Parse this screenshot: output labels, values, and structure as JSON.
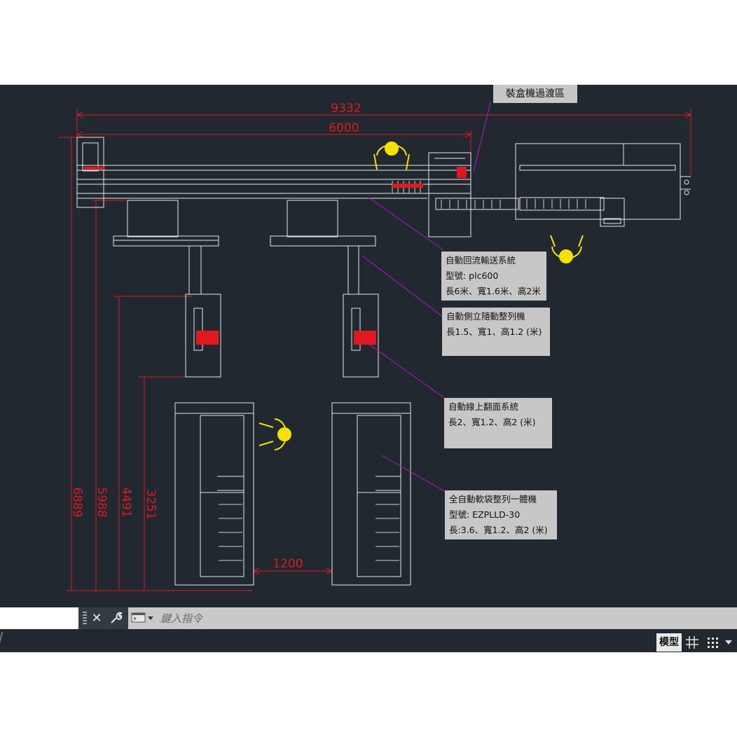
{
  "dimensions": {
    "total_width": "9332",
    "conveyor_length": "6000",
    "gap": "1200",
    "height_6889": "6889",
    "height_5988": "5988",
    "height_4491": "4491",
    "height_3251": "3251"
  },
  "labels": {
    "transition_zone": "裝盒機過渡區"
  },
  "callouts": {
    "return_conveyor": {
      "line1": "自動回流輸送系統",
      "line2": "型號: plc600",
      "line3": "長6米、寬1.6米、高2米"
    },
    "side_aligner": {
      "line1": "自動側立隨動整列機",
      "line2": "長1.5、寬1、高1.2 (米)"
    },
    "flip_system": {
      "line1": "自動線上翻面系統",
      "line2": "長2、寬1.2、高2 (米)"
    },
    "bag_aligner": {
      "line1": "全自動軟袋整列一體機",
      "line2": "型號: EZPLLD-30",
      "line3": "長:3.6、寬1.2、高2 (米)"
    }
  },
  "command_line": {
    "placeholder": "鍵入指令",
    "close_icon": "close-icon",
    "customize_icon": "wrench-icon",
    "prompt_icon": "command-prompt-icon"
  },
  "status_bar": {
    "model_tab": "模型",
    "grid_icon": "grid-icon",
    "snap_icon": "snap-grid-icon",
    "menu_icon": "chevron-down-icon"
  },
  "colors": {
    "canvas_bg": "#212830",
    "dimension": "#e0191f",
    "leader": "#b01bc9",
    "operator": "#f4e300",
    "linework": "#e6e6e6"
  }
}
